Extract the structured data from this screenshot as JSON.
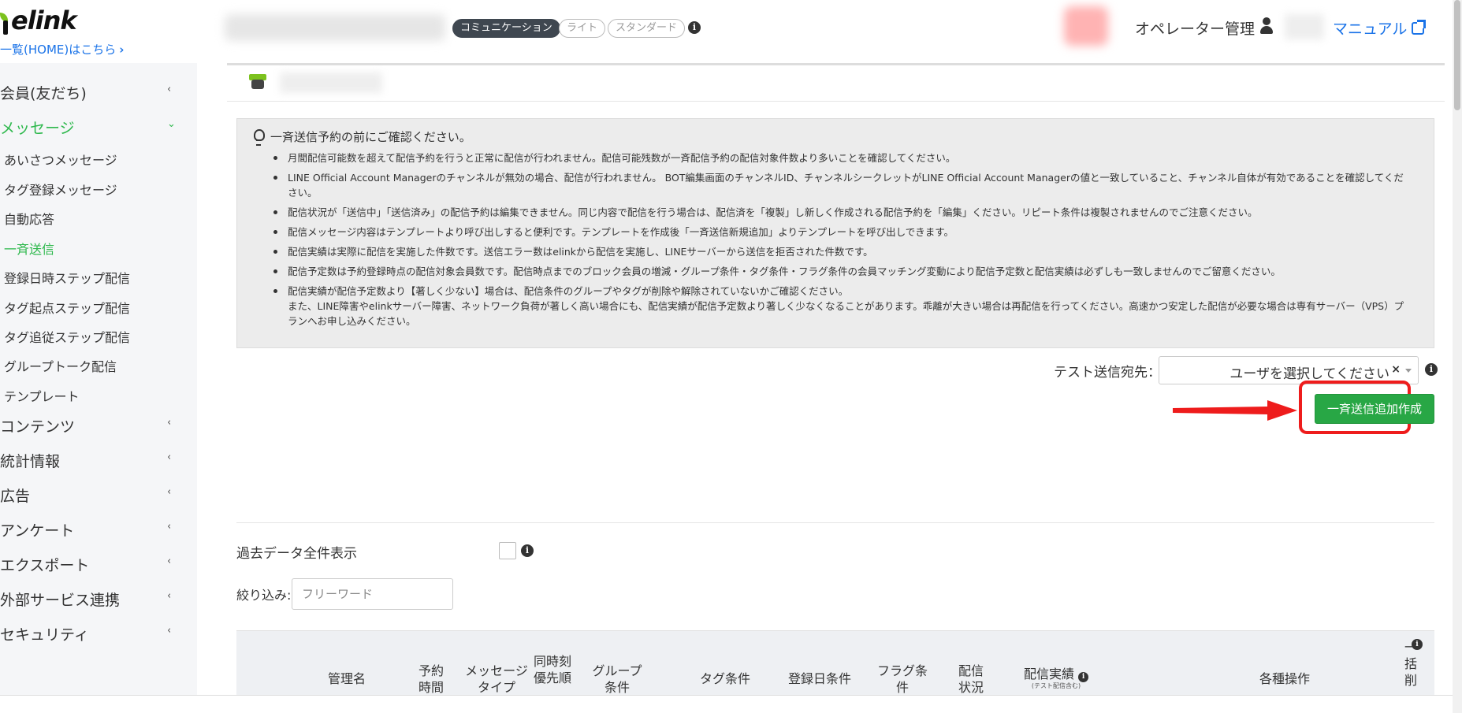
{
  "header": {
    "logo_text": "elink",
    "home_link": "一覧(HOME)はこちら",
    "plan_badges": [
      "コミュニケーション",
      "ライト",
      "スタンダード"
    ],
    "operator_label": "オペレーター管理",
    "manual_label": "マニュアル"
  },
  "sidebar": {
    "items": [
      {
        "label": "会員(友だち)",
        "caret": "‹"
      },
      {
        "label": "メッセージ",
        "caret": "⌄"
      },
      {
        "label": "コンテンツ",
        "caret": "‹"
      },
      {
        "label": "統計情報",
        "caret": "‹"
      },
      {
        "label": "広告",
        "caret": "‹"
      },
      {
        "label": "アンケート",
        "caret": "‹"
      },
      {
        "label": "エクスポート",
        "caret": "‹"
      },
      {
        "label": "外部サービス連携",
        "caret": "‹"
      },
      {
        "label": "セキュリティ",
        "caret": "‹"
      }
    ],
    "message_sub_items": [
      "あいさつメッセージ",
      "タグ登録メッセージ",
      "自動応答",
      "一斉送信",
      "登録日時ステップ配信",
      "タグ起点ステップ配信",
      "タグ追従ステップ配信",
      "グループトーク配信",
      "テンプレート"
    ]
  },
  "notice": {
    "title": "一斉送信予約の前にご確認ください。",
    "items": [
      "月間配信可能数を超えて配信予約を行うと正常に配信が行われません。配信可能残数が一斉配信予約の配信対象件数より多いことを確認してください。",
      "LINE Official Account Managerのチャンネルが無効の場合、配信が行われません。 BOT編集画面のチャンネルID、チャンネルシークレットがLINE Official Account Managerの値と一致していること、チャンネル自体が有効であることを確認してください。",
      "配信状況が「送信中」「送信済み」の配信予約は編集できません。同じ内容で配信を行う場合は、配信済を「複製」し新しく作成される配信予約を「編集」ください。リピート条件は複製されませんのでご注意ください。",
      "配信メッセージ内容はテンプレートより呼び出しすると便利です。テンプレートを作成後「一斉送信新規追加」よりテンプレートを呼び出しできます。",
      "配信実績は実際に配信を実施した件数です。送信エラー数はelinkから配信を実施し、LINEサーバーから送信を拒否された件数です。",
      "配信予定数は予約登録時点の配信対象会員数です。配信時点までのブロック会員の増減・グループ条件・タグ条件・フラグ条件の会員マッチング変動により配信予定数と配信実績は必ずしも一致しませんのでご留意ください。"
    ],
    "last_item_line1": "配信実績が配信予定数より【著しく少ない】場合は、配信条件のグループやタグが削除や解除されていないかご確認ください。",
    "last_item_line2": "また、LINE障害やelinkサーバー障害、ネットワーク負荷が著しく高い場合にも、配信実績が配信予定数より著しく少なくなることがあります。乖離が大きい場合は再配信を行ってください。高速かつ安定した配信が必要な場合は専有サーバー（VPS）プランへお申し込みください。"
  },
  "test_send": {
    "label": "テスト送信宛先：",
    "placeholder": "ユーザを選択してください",
    "clear": "×"
  },
  "add_button": "一斉送信追加作成",
  "past_data_label": "過去データ全件表示",
  "filter": {
    "label": "絞り込み:",
    "placeholder": "フリーワード"
  },
  "table_headers": [
    "管理名",
    "予約時間",
    "メッセージタイプ",
    "同時刻優先順",
    "グループ条件",
    "タグ条件",
    "登録日条件",
    "フラグ条件",
    "配信状況",
    "配信実績",
    "各種操作",
    "一括削"
  ],
  "table_header_note": "(テスト配信含む)",
  "info_glyph": "i",
  "colors": {
    "accent_green": "#2db84c",
    "button_green": "#28a745",
    "link_blue": "#1a73e8",
    "highlight_red": "#ee1c1c"
  }
}
